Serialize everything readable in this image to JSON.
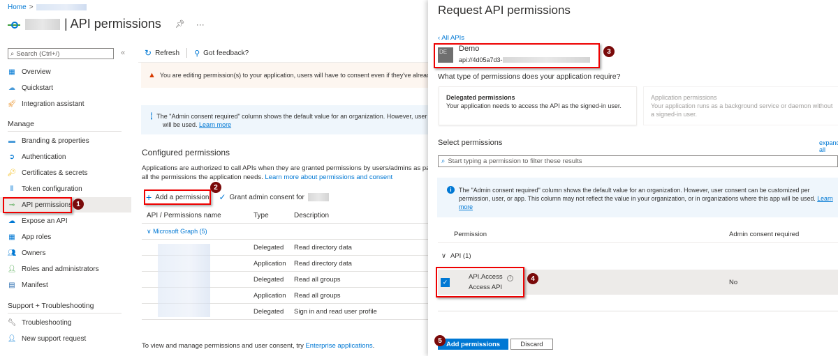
{
  "breadcrumb": {
    "home": "Home",
    "separator": ">"
  },
  "header": {
    "title": "| API permissions",
    "pin_icon": "pin-icon",
    "more_label": "···"
  },
  "sidebar": {
    "search_placeholder": "Search (Ctrl+/)",
    "collapse_label": "«",
    "top_items": [
      {
        "label": "Overview",
        "icon": "overview-icon"
      },
      {
        "label": "Quickstart",
        "icon": "quickstart-icon"
      },
      {
        "label": "Integration assistant",
        "icon": "rocket-icon"
      }
    ],
    "manage_header": "Manage",
    "manage_items": [
      {
        "label": "Branding & properties",
        "icon": "branding-icon"
      },
      {
        "label": "Authentication",
        "icon": "authentication-icon"
      },
      {
        "label": "Certificates & secrets",
        "icon": "key-icon"
      },
      {
        "label": "Token configuration",
        "icon": "token-icon"
      },
      {
        "label": "API permissions",
        "icon": "api-permissions-icon",
        "selected": true
      },
      {
        "label": "Expose an API",
        "icon": "cloud-icon"
      },
      {
        "label": "App roles",
        "icon": "app-roles-icon"
      },
      {
        "label": "Owners",
        "icon": "owners-icon"
      },
      {
        "label": "Roles and administrators",
        "icon": "roles-icon"
      },
      {
        "label": "Manifest",
        "icon": "manifest-icon"
      }
    ],
    "support_header": "Support + Troubleshooting",
    "support_items": [
      {
        "label": "Troubleshooting",
        "icon": "wrench-icon"
      },
      {
        "label": "New support request",
        "icon": "support-person-icon"
      }
    ]
  },
  "toolbar": {
    "refresh": "Refresh",
    "feedback": "Got feedback?"
  },
  "warning": {
    "text": "You are editing permission(s) to your application, users will have to consent even if they've already consented previously."
  },
  "info": {
    "text": "The \"Admin consent required\" column shows the default value for an organization. However, user consent can be customized per permission, user, or app. This column may not reflect the value in your organization, or in organizations where this app",
    "text2": "will be used.",
    "learn_more": "Learn more"
  },
  "configured": {
    "title": "Configured permissions",
    "desc1": "Applications are authorized to call APIs when they are granted permissions by users/admins as part of the consent process. The list of configured permissions should include",
    "desc2": "all the permissions the application needs.",
    "desc_link": "Learn more about permissions and consent",
    "add_permission": "Add a permission",
    "grant_consent": "Grant admin consent for",
    "columns": [
      "API / Permissions name",
      "Type",
      "Description"
    ],
    "group": "Microsoft Graph (5)",
    "rows": [
      {
        "type": "Delegated",
        "description": "Read directory data"
      },
      {
        "type": "Application",
        "description": "Read directory data"
      },
      {
        "type": "Delegated",
        "description": "Read all groups"
      },
      {
        "type": "Application",
        "description": "Read all groups"
      },
      {
        "type": "Delegated",
        "description": "Sign in and read user profile"
      }
    ],
    "footer": "To view and manage permissions and user consent, try",
    "footer_link": "Enterprise applications",
    "footer_end": "."
  },
  "panel": {
    "title": "Request API permissions",
    "back": "All APIs",
    "api_logo": "DE",
    "api_name": "Demo",
    "api_uri": "api://4d05a7d3-",
    "question": "What type of permissions does your application require?",
    "delegated": {
      "title": "Delegated permissions",
      "desc": "Your application needs to access the API as the signed-in user."
    },
    "application": {
      "title": "Application permissions",
      "desc": "Your application runs as a background service or daemon without a signed-in user."
    },
    "select_title": "Select permissions",
    "expand_all": "expand all",
    "filter_placeholder": "Start typing a permission to filter these results",
    "info1": "The \"Admin consent required\" column shows the default value for an organization. However, user consent can be customized per",
    "info2": "permission, user, or app. This column may not reflect the value in your organization, or in organizations where this app will be used.",
    "info_learn": "Learn",
    "info_more": "more",
    "col_permission": "Permission",
    "col_admin": "Admin consent required",
    "group": "API (1)",
    "perm_name": "API.Access",
    "perm_desc": "Access API",
    "perm_checked": true,
    "perm_admin": "No",
    "add_button": "Add permissions",
    "discard_button": "Discard"
  },
  "badges": [
    "1",
    "2",
    "3",
    "4",
    "5"
  ],
  "colors": {
    "accent": "#0078d4",
    "highlight": "#ee0000",
    "badge": "#7a0a0a"
  }
}
